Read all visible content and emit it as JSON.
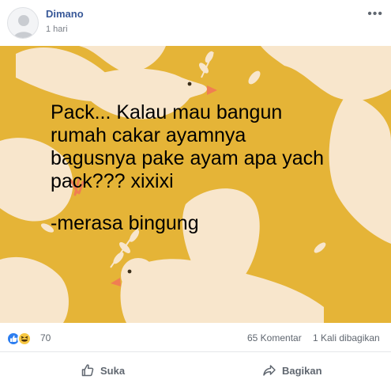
{
  "post": {
    "author": "Dimano",
    "time": "1 hari",
    "more_icon": "more-icon"
  },
  "image": {
    "background_color": "#e5b437",
    "dove_color": "#f8e6cc",
    "caption_lines": [
      "Pack... Kalau mau bangun",
      "rumah cakar ayamnya",
      "bagusnya pake ayam apa yach",
      "pack??? xixixi",
      "",
      "-merasa bingung"
    ]
  },
  "stats": {
    "reaction_icons": [
      "like-reaction-icon",
      "haha-reaction-icon"
    ],
    "reaction_count": "70",
    "comments": "65 Komentar",
    "shares": "1 Kali dibagikan"
  },
  "actions": {
    "like_label": "Suka",
    "share_label": "Bagikan"
  },
  "colors": {
    "author": "#385898",
    "muted_text": "#606770",
    "like_blue": "#2d7ef0",
    "haha_yellow": "#f7c843"
  }
}
